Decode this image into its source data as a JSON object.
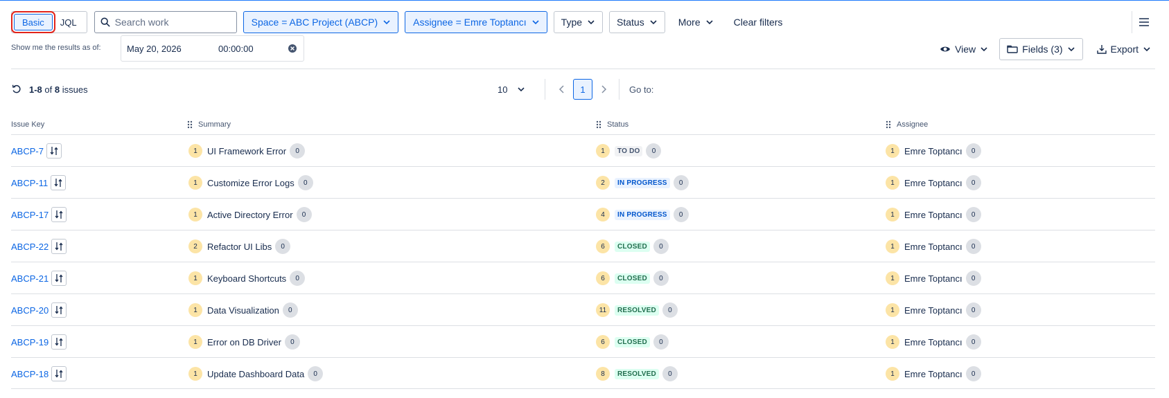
{
  "filter_bar": {
    "mode_basic": "Basic",
    "mode_jql": "JQL",
    "search_placeholder": "Search work",
    "chip_space": "Space = ABC Project (ABCP)",
    "chip_assignee": "Assignee = Emre Toptancı",
    "type_label": "Type",
    "status_label": "Status",
    "more_label": "More",
    "clear_label": "Clear filters"
  },
  "as_of": {
    "label": "Show me the results as of:",
    "date": "May 20, 2026",
    "time": "00:00:00"
  },
  "tools": {
    "view_label": "View",
    "fields_label": "Fields (3)",
    "export_label": "Export"
  },
  "results": {
    "range": "1-8",
    "of_word": "of",
    "total": "8",
    "unit": "issues"
  },
  "pager": {
    "page_size": "10",
    "current_page": "1",
    "goto_label": "Go to:"
  },
  "columns": {
    "key": "Issue Key",
    "summary": "Summary",
    "status": "Status",
    "assignee": "Assignee"
  },
  "rows": [
    {
      "key": "ABCP-7",
      "sum_n": "1",
      "summary": "UI Framework Error",
      "sum_c": "0",
      "st_n": "1",
      "status": "TO DO",
      "status_kind": "todo",
      "st_c": "0",
      "as_n": "1",
      "assignee": "Emre Toptancı",
      "as_c": "0"
    },
    {
      "key": "ABCP-11",
      "sum_n": "1",
      "summary": "Customize Error Logs",
      "sum_c": "0",
      "st_n": "2",
      "status": "IN PROGRESS",
      "status_kind": "progress",
      "st_c": "0",
      "as_n": "1",
      "assignee": "Emre Toptancı",
      "as_c": "0"
    },
    {
      "key": "ABCP-17",
      "sum_n": "1",
      "summary": "Active Directory Error",
      "sum_c": "0",
      "st_n": "4",
      "status": "IN PROGRESS",
      "status_kind": "progress",
      "st_c": "0",
      "as_n": "1",
      "assignee": "Emre Toptancı",
      "as_c": "0"
    },
    {
      "key": "ABCP-22",
      "sum_n": "2",
      "summary": "Refactor UI Libs",
      "sum_c": "0",
      "st_n": "6",
      "status": "CLOSED",
      "status_kind": "closed",
      "st_c": "0",
      "as_n": "1",
      "assignee": "Emre Toptancı",
      "as_c": "0"
    },
    {
      "key": "ABCP-21",
      "sum_n": "1",
      "summary": "Keyboard Shortcuts",
      "sum_c": "0",
      "st_n": "6",
      "status": "CLOSED",
      "status_kind": "closed",
      "st_c": "0",
      "as_n": "1",
      "assignee": "Emre Toptancı",
      "as_c": "0"
    },
    {
      "key": "ABCP-20",
      "sum_n": "1",
      "summary": "Data Visualization",
      "sum_c": "0",
      "st_n": "11",
      "status": "RESOLVED",
      "status_kind": "resolved",
      "st_c": "0",
      "as_n": "1",
      "assignee": "Emre Toptancı",
      "as_c": "0"
    },
    {
      "key": "ABCP-19",
      "sum_n": "1",
      "summary": "Error on DB Driver",
      "sum_c": "0",
      "st_n": "6",
      "status": "CLOSED",
      "status_kind": "closed",
      "st_c": "0",
      "as_n": "1",
      "assignee": "Emre Toptancı",
      "as_c": "0"
    },
    {
      "key": "ABCP-18",
      "sum_n": "1",
      "summary": "Update Dashboard Data",
      "sum_c": "0",
      "st_n": "8",
      "status": "RESOLVED",
      "status_kind": "resolved",
      "st_c": "0",
      "as_n": "1",
      "assignee": "Emre Toptancı",
      "as_c": "0"
    }
  ],
  "colors": {
    "accent": "#0c66e4",
    "highlight_box": "#e2231a",
    "todo": "#44546f",
    "in_progress": "#0055cc",
    "done": "#216e4e"
  },
  "icons": [
    "search-icon",
    "chevron-down-icon",
    "menu-icon",
    "close-circle-icon",
    "eye-icon",
    "fields-icon",
    "download-icon",
    "refresh-icon",
    "chevron-left-icon",
    "chevron-right-icon",
    "drag-handle-icon",
    "transition-icon"
  ]
}
